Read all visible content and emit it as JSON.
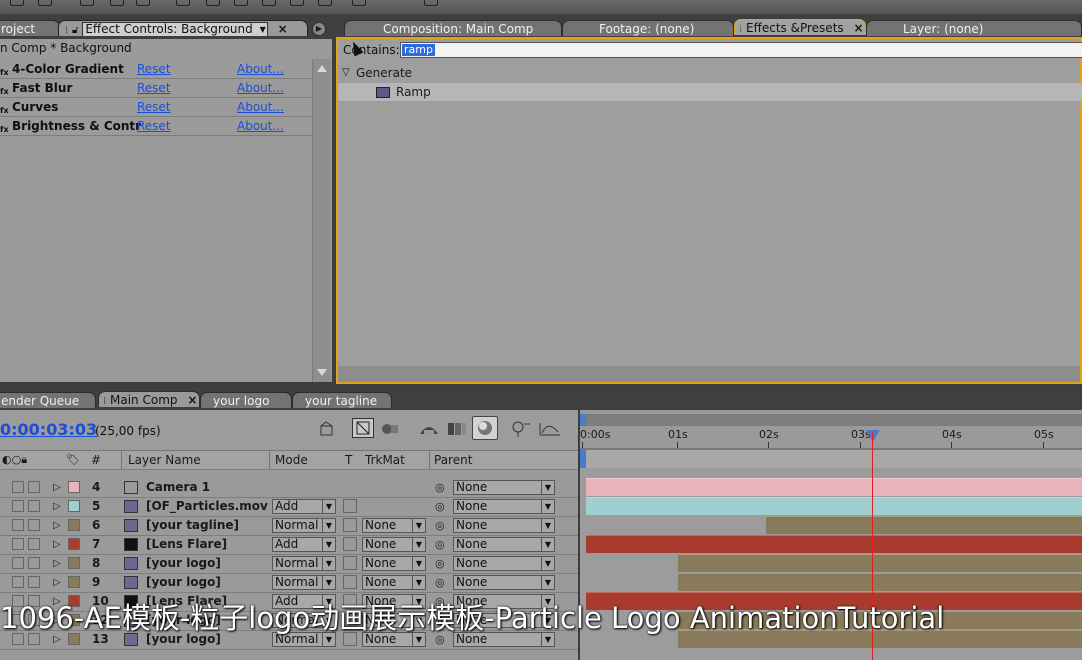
{
  "window_tabs_left": {
    "project": "roject",
    "effect_controls": "Effect Controls: Background"
  },
  "window_tabs_right": {
    "composition": "Composition: Main Comp",
    "footage": "Footage: (none)",
    "effects_presets": "Effects &Presets",
    "layer": "Layer: (none)"
  },
  "effect_controls": {
    "subtitle": "n Comp * Background",
    "effects": [
      {
        "name": "4-Color Gradient",
        "reset": "Reset",
        "about": "About..."
      },
      {
        "name": "Fast Blur",
        "reset": "Reset",
        "about": "About..."
      },
      {
        "name": "Curves",
        "reset": "Reset",
        "about": "About..."
      },
      {
        "name": "Brightness & Contr",
        "reset": "Reset",
        "about": "About..."
      }
    ],
    "fx_badge": "fx"
  },
  "effects_presets": {
    "contains_label": "Contains:",
    "search_value": "ramp",
    "tree": [
      {
        "label": "Generate",
        "kind": "folder"
      },
      {
        "label": "Ramp",
        "kind": "effect"
      }
    ]
  },
  "timeline_tabs": {
    "render_queue": "ender Queue",
    "main_comp": "Main Comp",
    "your_logo": "your logo",
    "your_tagline": "your tagline"
  },
  "timeline": {
    "timecode": "0:00:03:03",
    "fps": "(25,00 fps)",
    "columns": {
      "num": "#",
      "layer_name": "Layer Name",
      "mode": "Mode",
      "t": "T",
      "trkmat": "TrkMat",
      "parent": "Parent"
    },
    "ruler_ticks": [
      "0:00s",
      "01s",
      "02s",
      "03s",
      "04s",
      "05s"
    ],
    "layers": [
      {
        "num": "4",
        "name": "Camera 1",
        "mode": "",
        "trkmat": "",
        "parent": "None",
        "label_color": "#e7b3bd",
        "icon": "camera-icon"
      },
      {
        "num": "5",
        "name": "[OF_Particles.mov",
        "mode": "Add",
        "trkmat": "",
        "parent": "None",
        "label_color": "#9fd0cf",
        "icon": "footage-icon"
      },
      {
        "num": "6",
        "name": "[your tagline]",
        "mode": "Normal",
        "trkmat": "None",
        "parent": "None",
        "label_color": "#8a7a5c",
        "icon": "comp-icon"
      },
      {
        "num": "7",
        "name": "[Lens Flare]",
        "mode": "Add",
        "trkmat": "None",
        "parent": "None",
        "label_color": "#a83a2e",
        "icon": "solid-icon"
      },
      {
        "num": "8",
        "name": "[your logo]",
        "mode": "Normal",
        "trkmat": "None",
        "parent": "None",
        "label_color": "#8a7a5c",
        "icon": "comp-icon"
      },
      {
        "num": "9",
        "name": "[your logo]",
        "mode": "Normal",
        "trkmat": "None",
        "parent": "None",
        "label_color": "#8a7a5c",
        "icon": "comp-icon"
      },
      {
        "num": "10",
        "name": "[Lens Flare]",
        "mode": "Add",
        "trkmat": "None",
        "parent": "None",
        "label_color": "#a83a2e",
        "icon": "solid-icon"
      },
      {
        "num": "12",
        "name": "[your logo]",
        "mode": "Normal",
        "trkmat": "None",
        "parent": "None",
        "label_color": "#8a7a5c",
        "icon": "comp-icon"
      },
      {
        "num": "13",
        "name": "[your logo]",
        "mode": "Normal",
        "trkmat": "None",
        "parent": "None",
        "label_color": "#8a7a5c",
        "icon": "comp-icon"
      }
    ]
  },
  "colors": {
    "panel_focus": "#e4a21c",
    "playhead": "#e02020",
    "link": "#1a4fd6",
    "timecode": "#1a4fd6"
  },
  "subtitle": "1096-AE模板-粒子logo动画展示模板-Particle Logo AnimationTutorial"
}
